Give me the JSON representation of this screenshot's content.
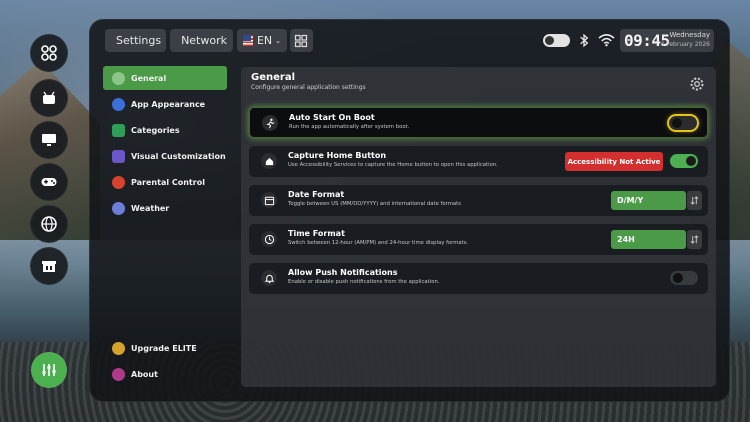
{
  "topbar": {
    "settings_label": "Settings",
    "network_label": "Network",
    "language_label": "EN",
    "clock_time": "09:45",
    "clock_day": "Wednesday",
    "clock_date": "4 February 2026"
  },
  "sidebar": {
    "items": [
      {
        "label": "General",
        "icon": "gear-icon",
        "color": "#4a9a47",
        "active": true
      },
      {
        "label": "App Appearance",
        "icon": "apps-icon",
        "color": "#3b6ed8"
      },
      {
        "label": "Categories",
        "icon": "grid-icon",
        "color": "#2e9e58"
      },
      {
        "label": "Visual Customization",
        "icon": "image-icon",
        "color": "#6b56c8"
      },
      {
        "label": "Parental Control",
        "icon": "lock-icon",
        "color": "#d6432e"
      },
      {
        "label": "Weather",
        "icon": "cloud-icon",
        "color": "#6b7fd9"
      }
    ],
    "bottom": [
      {
        "label": "Upgrade ELITE",
        "icon": "crown-icon",
        "color": "#d7a22a"
      },
      {
        "label": "About",
        "icon": "info-icon",
        "color": "#b03a8a"
      }
    ]
  },
  "content": {
    "title": "General",
    "subtitle": "Configure general application settings"
  },
  "rows": [
    {
      "title": "Auto Start On Boot",
      "desc": "Run the app automatically after system boot.",
      "control": "switch",
      "on": false,
      "focused": true
    },
    {
      "title": "Capture Home Button",
      "desc": "Use Accessibility Services to capture the Home button to open this application.",
      "control": "switch",
      "on": true,
      "badge": "Accessibility Not Active"
    },
    {
      "title": "Date Format",
      "desc": "Toggle between US (MM/DD/YYYY) and international date formats",
      "control": "select",
      "value": "D/M/Y"
    },
    {
      "title": "Time Format",
      "desc": "Switch between 12-hour (AM/PM) and 24-hour time display formats.",
      "control": "select",
      "value": "24H"
    },
    {
      "title": "Allow Push Notifications",
      "desc": "Enable or disable push notifications from the application.",
      "control": "switch",
      "on": false
    }
  ],
  "colors": {
    "accent": "#4caf50",
    "warning": "#d32f2f",
    "focus": "#e6c21c"
  }
}
